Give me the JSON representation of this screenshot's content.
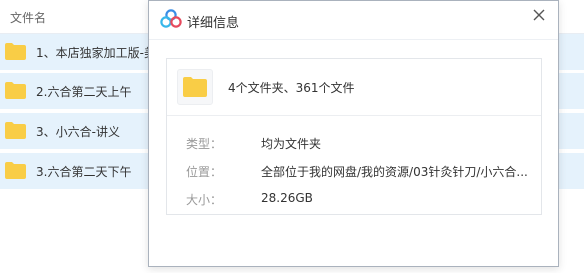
{
  "file_list": {
    "column_header": "文件名",
    "rows": [
      {
        "name": "1、本店独家加工版-美"
      },
      {
        "name": "2.六合第二天上午"
      },
      {
        "name": "3、小六合-讲义"
      },
      {
        "name": "3.六合第二天下午"
      }
    ]
  },
  "dialog": {
    "title": "详细信息",
    "summary": "4个文件夹、361个文件",
    "type_label": "类型：",
    "type_value": "均为文件夹",
    "location_label": "位置：",
    "location_value": "全部位于我的网盘/我的资源/03针灸针刀/小六合...",
    "size_label": "大小：",
    "size_value": "28.26GB"
  },
  "colors": {
    "row_selected": "#e5f2fc",
    "folder_yellow": "#f9cd46",
    "brand_blue": "#3a8ee6"
  },
  "icons": {
    "logo": "baidu-netdisk-logo-icon",
    "close": "close-icon",
    "folder": "folder-icon"
  }
}
